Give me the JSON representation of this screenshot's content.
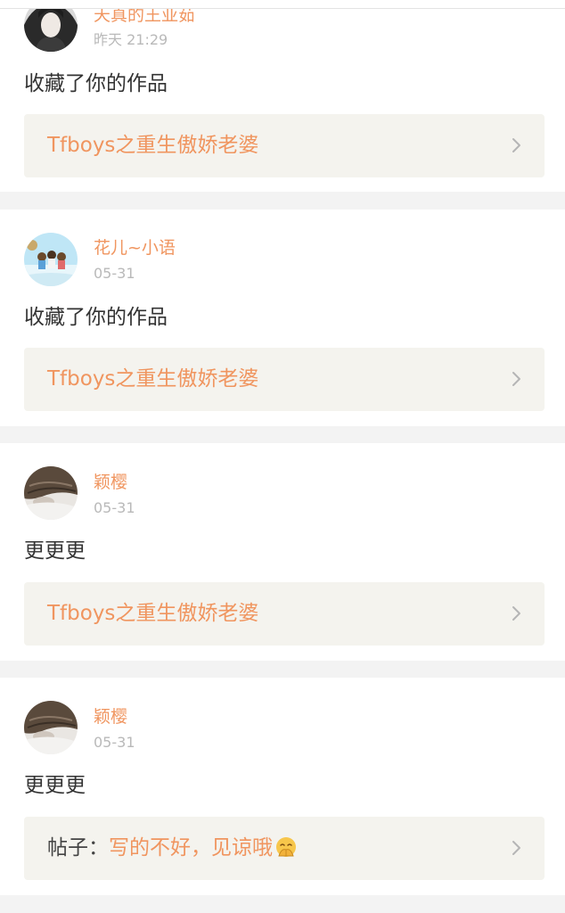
{
  "feed": [
    {
      "username": "天真的王亚茹",
      "time": "昨天 21:29",
      "action": "收藏了你的作品",
      "link": {
        "prefix": "",
        "text": "Tfboys之重生傲娇老婆",
        "emoji": ""
      }
    },
    {
      "username": "花儿~小语",
      "time": "05-31",
      "action": "收藏了你的作品",
      "link": {
        "prefix": "",
        "text": "Tfboys之重生傲娇老婆",
        "emoji": ""
      }
    },
    {
      "username": "颖樱",
      "time": "05-31",
      "action": "更更更",
      "link": {
        "prefix": "",
        "text": "Tfboys之重生傲娇老婆",
        "emoji": ""
      }
    },
    {
      "username": "颖樱",
      "time": "05-31",
      "action": "更更更",
      "link": {
        "prefix": "帖子：",
        "text": "写的不好，见谅哦",
        "emoji": "pleading-hands-emoji"
      }
    }
  ],
  "colors": {
    "accent": "#f0955f",
    "muted": "#b9b9b9",
    "text": "#333333",
    "linkBox": "#f4f3ee",
    "divider": "#f3f3f3"
  },
  "icons": {
    "chevron": "chevron-right-icon",
    "avatar": "avatar-image"
  }
}
